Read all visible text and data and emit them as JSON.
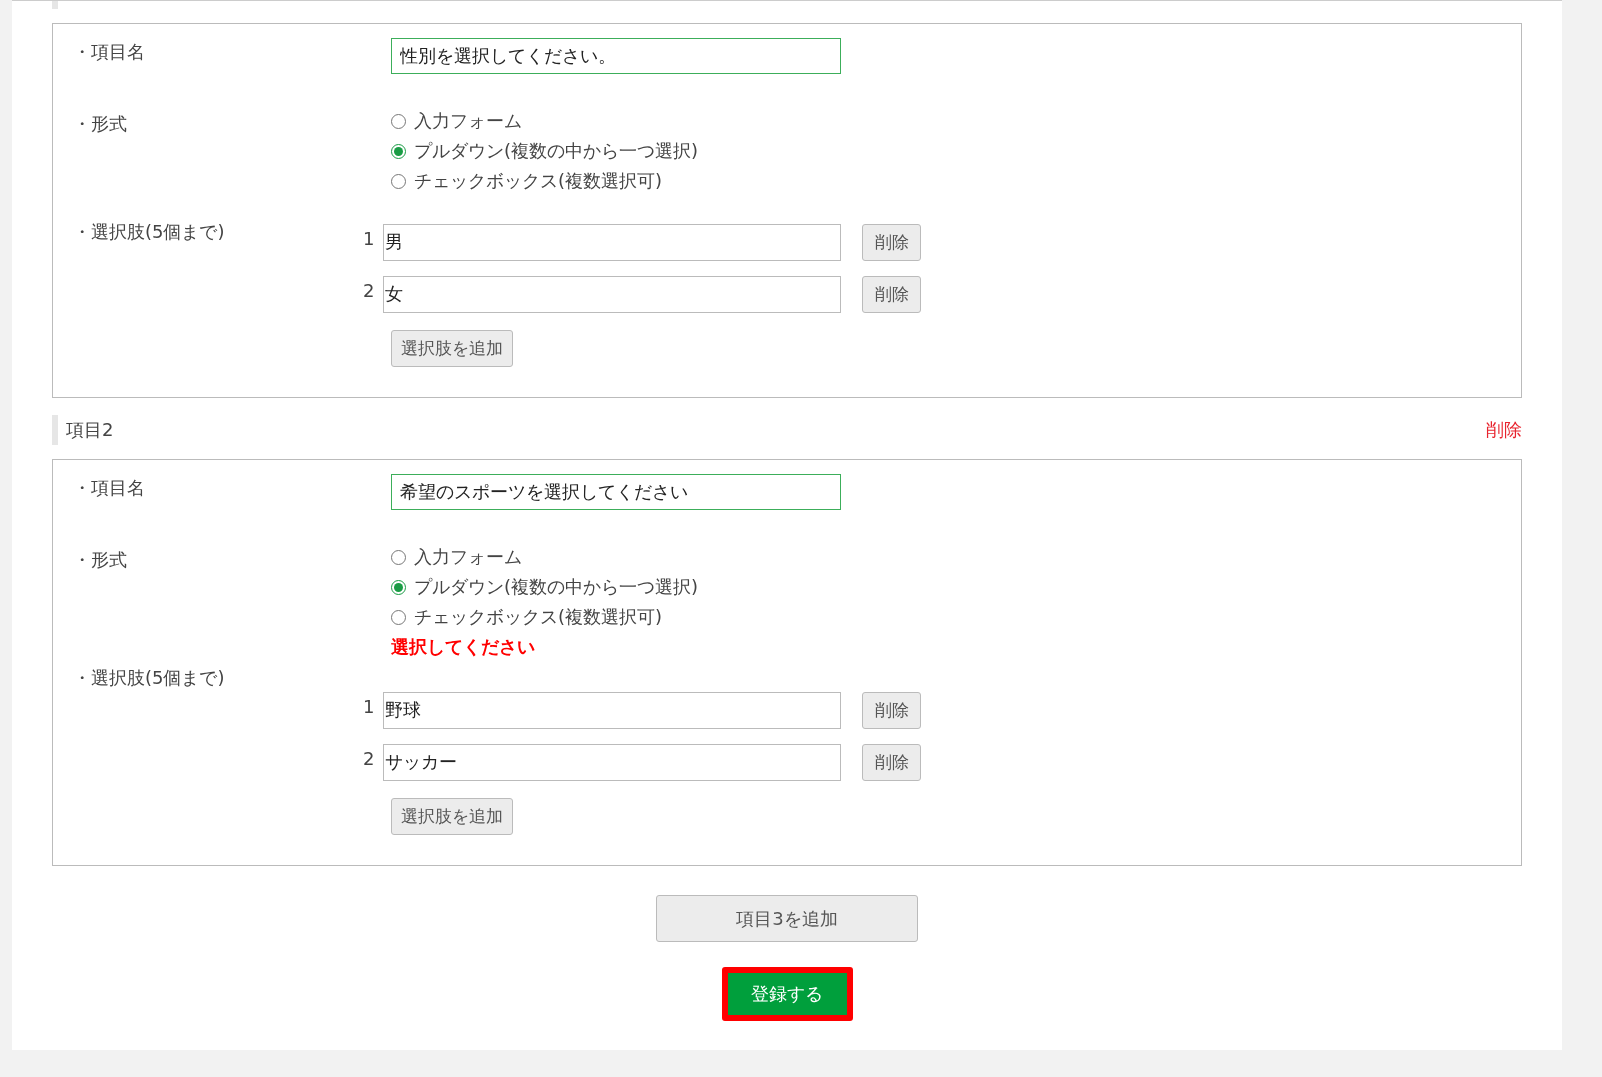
{
  "items": [
    {
      "name_label": "・項目名",
      "name_value": "性別を選択してください。",
      "format_label": "・形式",
      "formats": [
        {
          "label": "入力フォーム",
          "selected": false
        },
        {
          "label": "プルダウン(複数の中から一つ選択)",
          "selected": true
        },
        {
          "label": "チェックボックス(複数選択可)",
          "selected": false
        }
      ],
      "choices_label": "・選択肢(5個まで)",
      "choices": [
        {
          "number": "1",
          "value": "男",
          "delete": "削除"
        },
        {
          "number": "2",
          "value": "女",
          "delete": "削除"
        }
      ],
      "add_choice": "選択肢を追加"
    },
    {
      "header": {
        "title": "項目2",
        "delete": "削除"
      },
      "name_label": "・項目名",
      "name_value": "希望のスポーツを選択してください",
      "format_label": "・形式",
      "formats": [
        {
          "label": "入力フォーム",
          "selected": false
        },
        {
          "label": "プルダウン(複数の中から一つ選択)",
          "selected": true
        },
        {
          "label": "チェックボックス(複数選択可)",
          "selected": false
        }
      ],
      "error": "選択してください",
      "choices_label": "・選択肢(5個まで)",
      "choices": [
        {
          "number": "1",
          "value": "野球",
          "delete": "削除"
        },
        {
          "number": "2",
          "value": "サッカー",
          "delete": "削除"
        }
      ],
      "add_choice": "選択肢を追加"
    }
  ],
  "add_item": "項目3を追加",
  "submit": {
    "label": "登録する",
    "highlighted": true
  }
}
